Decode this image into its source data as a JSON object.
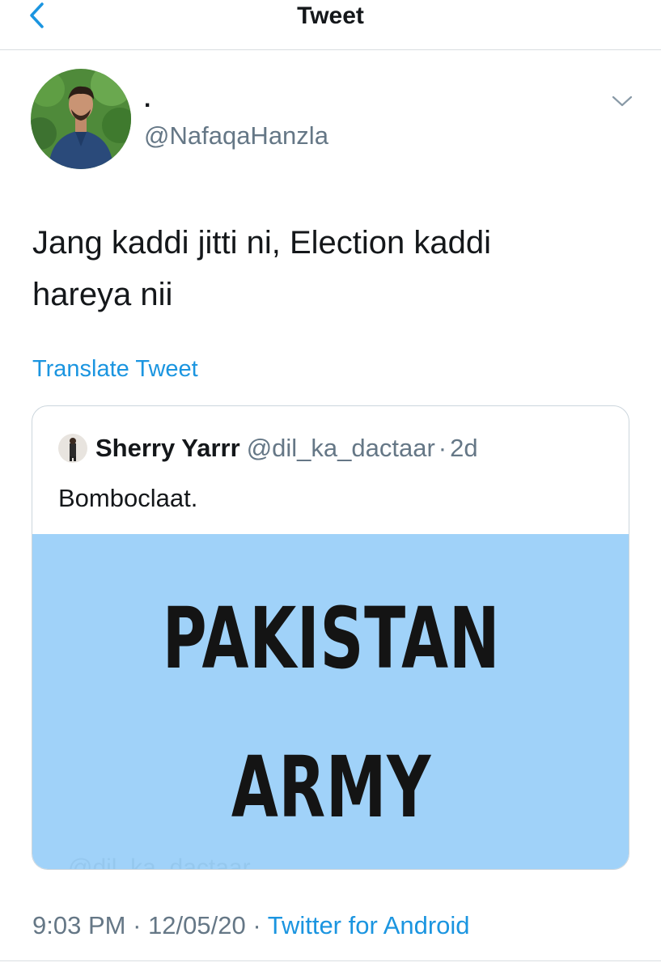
{
  "header": {
    "title": "Tweet",
    "back_icon": "chevron-left-icon"
  },
  "author": {
    "display_name": ".",
    "handle": "@NafaqaHanzla",
    "menu_icon": "chevron-down-icon"
  },
  "tweet": {
    "text_line1": "Jang kaddi jitti ni, Election kaddi",
    "text_line2": "hareya nii",
    "translate_label": "Translate Tweet"
  },
  "quoted_tweet": {
    "display_name": "Sherry Yarrr",
    "handle": "@dil_ka_dactaar",
    "separator": "·",
    "time": "2d",
    "text": "Bomboclaat.",
    "media": {
      "line1": "PAKISTAN",
      "line2": "ARMY",
      "watermark": "@dil_ka_dactaar",
      "background": "#a0d2f9"
    }
  },
  "meta": {
    "time": "9:03 PM",
    "dot1": "·",
    "date": "12/05/20",
    "dot2": "·",
    "source": "Twitter for Android"
  },
  "colors": {
    "link": "#1b95e0",
    "secondary_text": "#657786",
    "primary_text": "#14171a"
  }
}
